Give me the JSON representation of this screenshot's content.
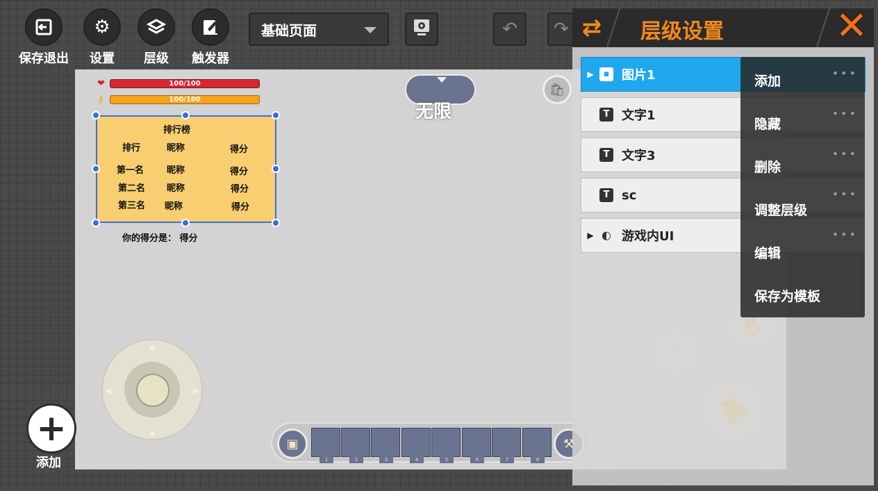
{
  "toolbar": {
    "exit_label": "保存退出",
    "settings_label": "设置",
    "layers_label": "层级",
    "trigger_label": "触发器",
    "page_select_value": "基础页面"
  },
  "hud": {
    "hp_text": "100/100",
    "hp_fill": 1.0,
    "mp_text": "100/100",
    "mp_fill": 1.0,
    "timer_text": "无限"
  },
  "leaderboard": {
    "title": "排行榜",
    "headers": [
      "排行",
      "昵称",
      "得分"
    ],
    "rows": [
      [
        "第一名",
        "昵称",
        "得分"
      ],
      [
        "第二名",
        "昵称",
        "得分"
      ],
      [
        "第三名",
        "昵称",
        "得分"
      ]
    ]
  },
  "score_line": "你的得分是：  得分",
  "hotbar": {
    "slots": [
      "1",
      "2",
      "3",
      "4",
      "5",
      "6",
      "7",
      "8"
    ]
  },
  "add_button": {
    "label": "添加"
  },
  "panel": {
    "title": "层级设置",
    "layers": [
      {
        "label": "图片1",
        "icon": "image-icon",
        "expandable": true,
        "selected": true
      },
      {
        "label": "文字1",
        "icon": "text-icon",
        "expandable": false,
        "selected": false
      },
      {
        "label": "文字3",
        "icon": "text-icon",
        "expandable": false,
        "selected": false
      },
      {
        "label": "sc",
        "icon": "text-icon",
        "expandable": false,
        "selected": false
      },
      {
        "label": "游戏内UI",
        "icon": "toggle-icon",
        "expandable": true,
        "selected": false
      }
    ]
  },
  "context_menu": {
    "items": [
      "添加",
      "隐藏",
      "删除",
      "调整层级",
      "编辑",
      "保存为模板"
    ]
  },
  "colors": {
    "accent": "#f28a1d",
    "selected_row": "#1fa8ee",
    "hp_bar": "#d9262f",
    "mp_bar": "#f5a21b",
    "leaderboard_bg": "#f8ce70"
  }
}
